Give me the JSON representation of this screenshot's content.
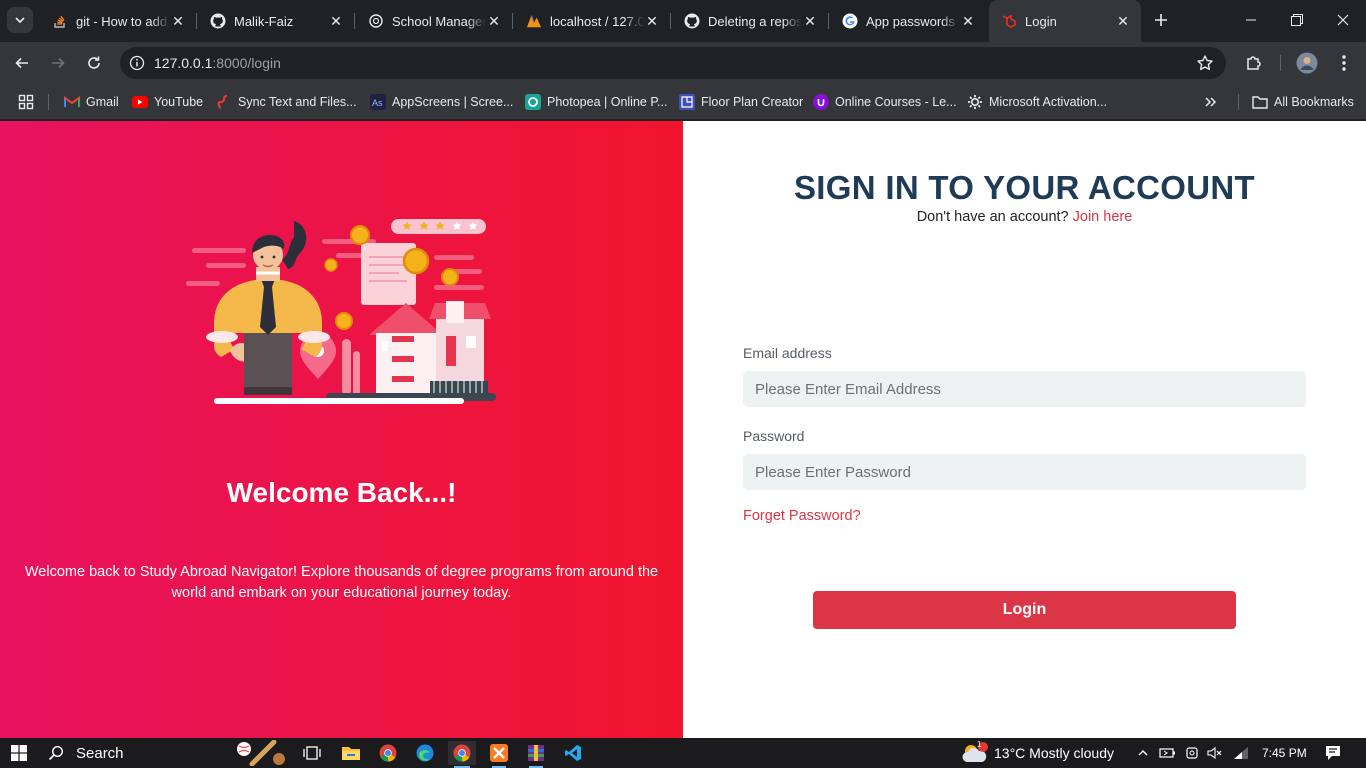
{
  "tabs": [
    {
      "title": "git - How to add",
      "icon": "stackoverflow-icon"
    },
    {
      "title": "Malik-Faiz",
      "icon": "github-icon"
    },
    {
      "title": "School Managem",
      "icon": "chatgpt-icon"
    },
    {
      "title": "localhost / 127.0",
      "icon": "phpmyadmin-icon"
    },
    {
      "title": "Deleting a repos",
      "icon": "github-icon"
    },
    {
      "title": "App passwords",
      "icon": "google-icon"
    },
    {
      "title": "Login",
      "icon": "laravel-icon"
    }
  ],
  "address_bar": {
    "host": "127.0.0.1",
    "path": ":8000/login"
  },
  "bookmarks": [
    {
      "label": "Gmail",
      "icon": "gmail-icon"
    },
    {
      "label": "YouTube",
      "icon": "youtube-icon"
    },
    {
      "label": "Sync Text and Files...",
      "icon": "sync-icon"
    },
    {
      "label": "AppScreens | Scree...",
      "icon": "appscreens-icon"
    },
    {
      "label": "Photopea | Online P...",
      "icon": "photopea-icon"
    },
    {
      "label": "Floor Plan Creator",
      "icon": "floorplan-icon"
    },
    {
      "label": "Online Courses - Le...",
      "icon": "udemy-icon"
    },
    {
      "label": "Microsoft Activation...",
      "icon": "gear-icon"
    }
  ],
  "all_bookmarks_label": "All Bookmarks",
  "left_panel": {
    "title": "Welcome Back...!",
    "text": "Welcome back to Study Abroad Navigator! Explore thousands of degree programs from around the world and embark on your educational journey today.",
    "illustration_stars": 5
  },
  "login": {
    "title": "SIGN IN TO YOUR ACCOUNT",
    "subtitle": "Don't have an account?",
    "join_link": "Join here",
    "email_label": "Email address",
    "email_placeholder": "Please Enter Email Address",
    "password_label": "Password",
    "password_placeholder": "Please Enter Password",
    "forgot_link": "Forget Password?",
    "submit_label": "Login"
  },
  "taskbar": {
    "search_label": "Search",
    "weather": "13°C  Mostly cloudy",
    "weather_badge": "1",
    "time": "7:45 PM"
  },
  "colors": {
    "accent": "#dc3545",
    "heading": "#1f3b55",
    "left_bg_start": "#e8125f",
    "left_bg_end": "#f0152d"
  }
}
